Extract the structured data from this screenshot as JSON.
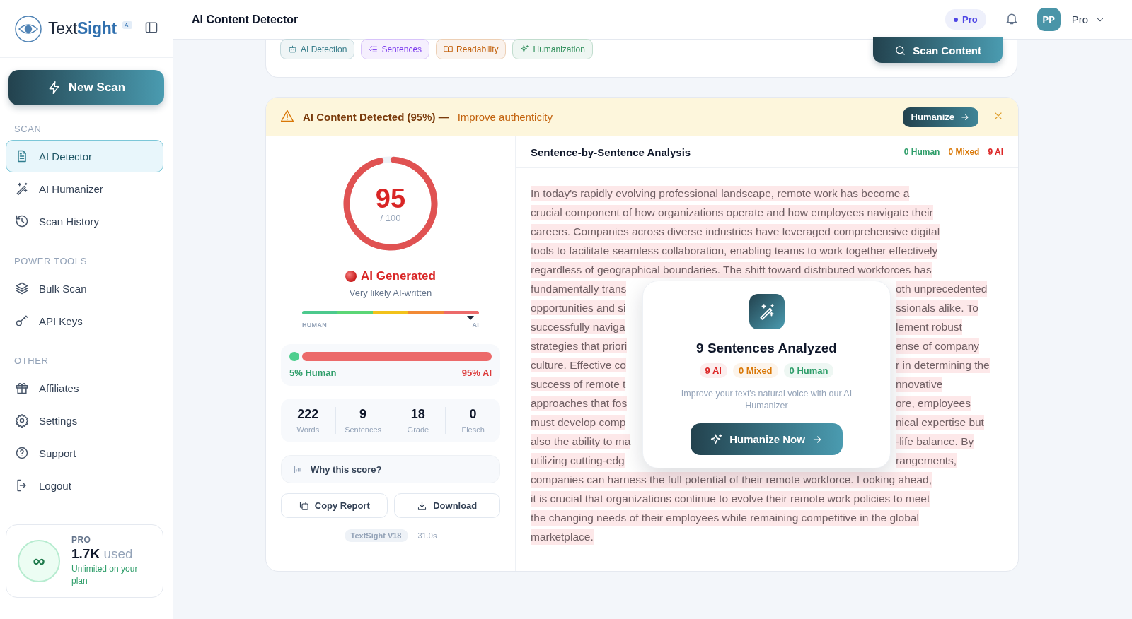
{
  "sidebar": {
    "logo": {
      "text": "Text",
      "accent": "Sight",
      "badge": "AI"
    },
    "new_scan": "New Scan",
    "sections": [
      {
        "title": "SCAN",
        "items": [
          {
            "label": "AI Detector",
            "kind": "doc",
            "selected": true
          },
          {
            "label": "AI Humanizer",
            "kind": "wand",
            "selected": false
          },
          {
            "label": "Scan History",
            "kind": "history",
            "selected": false
          }
        ]
      },
      {
        "title": "POWER TOOLS",
        "items": [
          {
            "label": "Bulk Scan",
            "kind": "layers",
            "selected": false
          },
          {
            "label": "API Keys",
            "kind": "key",
            "selected": false
          }
        ]
      },
      {
        "title": "OTHER",
        "items": [
          {
            "label": "Affiliates",
            "kind": "gift",
            "selected": false
          },
          {
            "label": "Settings",
            "kind": "gear",
            "selected": false
          },
          {
            "label": "Support",
            "kind": "help",
            "selected": false
          },
          {
            "label": "Logout",
            "kind": "logout",
            "selected": false
          }
        ]
      }
    ],
    "plan": {
      "symbol": "∞",
      "tier": "PRO",
      "used_value": "1.7K",
      "used_label": "used",
      "note": "Unlimited on your plan"
    }
  },
  "header": {
    "title": "AI Content Detector",
    "badge": "Pro",
    "avatar": "PP",
    "user": "Pro"
  },
  "tool_card": {
    "tags": [
      {
        "label": "AI Detection",
        "kind": "robot",
        "color": "#3a7f8c"
      },
      {
        "label": "Sentences",
        "kind": "list",
        "color": "#7c3aed"
      },
      {
        "label": "Readability",
        "kind": "book",
        "color": "#c2610c"
      },
      {
        "label": "Humanization",
        "kind": "sparkle",
        "color": "#2f8f5b"
      }
    ],
    "scan_button": "Scan Content"
  },
  "alert": {
    "title": "AI Content Detected (95%) —",
    "link": "Improve authenticity",
    "button": "Humanize"
  },
  "score": {
    "value": "95",
    "max": "/ 100",
    "level": 0.95,
    "verdict": "AI Generated",
    "verdict_note": "Very likely AI-written"
  },
  "scale": {
    "left": "HUMAN",
    "right": "AI",
    "level": 0.95
  },
  "split": {
    "level": 0.05,
    "human": "5% Human",
    "ai": "95% AI"
  },
  "stats": [
    {
      "value": "222",
      "label": "Words"
    },
    {
      "value": "9",
      "label": "Sentences"
    },
    {
      "value": "18",
      "label": "Grade"
    },
    {
      "value": "0",
      "label": "Flesch"
    }
  ],
  "why": "Why this score?",
  "actions": [
    {
      "label": "Copy Report",
      "kind": "copy"
    },
    {
      "label": "Download",
      "kind": "download"
    }
  ],
  "footer": {
    "model": "TextSight V18",
    "time": "31.0s"
  },
  "analysis": {
    "title": "Sentence-by-Sentence Analysis",
    "counts": [
      {
        "label": "0 Human",
        "color": "#2f9e6a"
      },
      {
        "label": "0 Mixed",
        "color": "#d97706"
      },
      {
        "label": "9 AI",
        "color": "#dc2626"
      }
    ],
    "lines": [
      {
        "left": "In today's rapidly evolving professional landscape, remote work has become a"
      },
      {
        "left": "crucial component of how organizations operate and how employees navigate their"
      },
      {
        "left": "careers.  Companies across diverse industries have leveraged comprehensive digital"
      },
      {
        "left": "tools to facilitate seamless collaboration, enabling teams to work together effectively"
      },
      {
        "left": "regardless of geographical boundaries.  The shift toward distributed workforces has"
      },
      {
        "left": "fundamentally trans",
        "right": "oth unprecedented"
      },
      {
        "left": "opportunities and si",
        "right": "ssionals alike.  To"
      },
      {
        "left": "successfully naviga",
        "right": "lement robust"
      },
      {
        "left": "strategies that priori",
        "right": "ense of company"
      },
      {
        "left": "culture.  Effective co",
        "right": "r in determining the"
      },
      {
        "left": "success of remote t",
        "right": "nnovative"
      },
      {
        "left": "approaches that fos",
        "right": "ore, employees"
      },
      {
        "left": "must develop comp",
        "right": "nical expertise but"
      },
      {
        "left": "also the ability to ma",
        "right": "-life balance.  By"
      },
      {
        "left": "utilizing cutting-edg",
        "right": "rangements,"
      },
      {
        "left": "companies can harness the full potential of their remote workforce.  Looking ahead,"
      },
      {
        "left": "it is crucial that organizations continue to evolve their remote work policies to meet"
      },
      {
        "left": "the changing needs of their employees while remaining competitive in the global"
      },
      {
        "left": "marketplace."
      }
    ]
  },
  "modal": {
    "title": "9 Sentences Analyzed",
    "chips": [
      {
        "label": "9 AI",
        "color": "#dc2626"
      },
      {
        "label": "0 Mixed",
        "color": "#d97706"
      },
      {
        "label": "0 Human",
        "color": "#2f9e6a"
      }
    ],
    "text": "Improve your text's natural voice with our AI Humanizer",
    "button": "Humanize Now"
  }
}
